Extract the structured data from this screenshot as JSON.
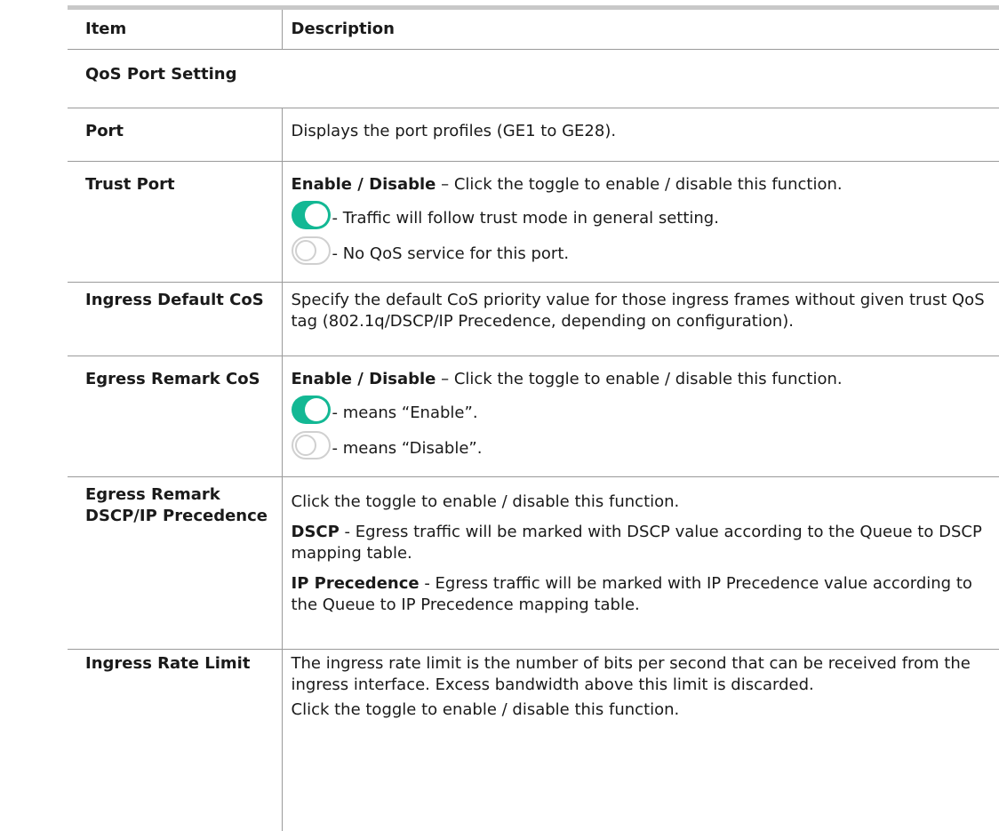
{
  "header": {
    "item": "Item",
    "description": "Description"
  },
  "section": "QoS Port Setting",
  "rows": {
    "port": {
      "item": "Port",
      "desc": "Displays the port profiles (GE1 to GE28)."
    },
    "trust_port": {
      "item": "Trust Port",
      "lead_bold": "Enable / Disable",
      "lead_text": " – Click the toggle to enable / disable this function.",
      "on_text": "- Traffic will follow trust mode in general setting.",
      "off_text": "- No QoS service for this port."
    },
    "ingress_default_cos": {
      "item": "Ingress Default CoS",
      "desc": "Specify the default CoS priority value for those ingress frames without given trust QoS tag (802.1q/DSCP/IP Precedence, depending on configuration)."
    },
    "egress_remark_cos": {
      "item": "Egress Remark CoS",
      "lead_bold": "Enable / Disable",
      "lead_text": " – Click the toggle to enable / disable this function.",
      "on_text": "- means “Enable”.",
      "off_text": "- means “Disable”."
    },
    "egress_remark_dscp": {
      "item_line1": "Egress Remark",
      "item_line2": "DSCP/IP Precedence",
      "p1": "Click the toggle to enable / disable this function.",
      "dscp_bold": "DSCP",
      "dscp_text": " - Egress traffic will be marked with DSCP value according to the Queue to DSCP mapping table.",
      "ipp_bold": "IP Precedence",
      "ipp_text": " - Egress traffic will be marked with IP Precedence value according to the Queue to IP Precedence mapping table."
    },
    "ingress_rate_limit": {
      "item": "Ingress Rate Limit",
      "p1": "The ingress rate limit is the number of bits per second that can be received from the ingress interface. Excess bandwidth above this limit is discarded.",
      "p2": "Click the toggle to enable / disable this function."
    }
  },
  "toggle_colors": {
    "on": "#13b894",
    "off_border": "#d0d0d0"
  }
}
